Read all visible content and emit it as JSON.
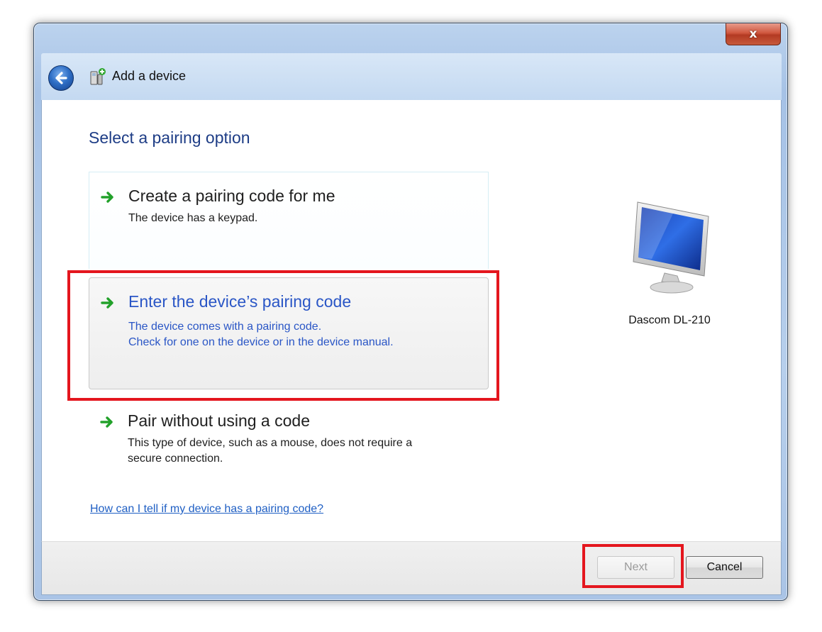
{
  "window": {
    "title": "Add a device",
    "close_symbol": "x",
    "icons": {
      "back": "back-arrow-icon",
      "title": "add-device-icon",
      "close": "close-icon"
    }
  },
  "page": {
    "heading": "Select a pairing option"
  },
  "options": [
    {
      "title": "Create a pairing code for me",
      "description": [
        "The device has a keypad."
      ],
      "icon": "green-arrow-icon",
      "style": "normal"
    },
    {
      "title": "Enter the device’s pairing code",
      "description": [
        "The device comes with a pairing code.",
        "Check for one on the device or in the device manual."
      ],
      "icon": "green-arrow-icon",
      "style": "hovered"
    },
    {
      "title": "Pair without using a code",
      "description": [
        "This type of device, such as a mouse, does not require a",
        "secure connection."
      ],
      "icon": "green-arrow-icon",
      "style": "normal"
    }
  ],
  "help_link": "How can I tell if my device has a pairing code?",
  "device": {
    "name": "Dascom DL-210",
    "icon": "monitor-icon"
  },
  "buttons": {
    "next": "Next",
    "next_enabled": false,
    "cancel": "Cancel"
  },
  "colors": {
    "highlight": "#e4161e",
    "link_blue": "#2a56c6",
    "heading_blue": "#1e3d86",
    "arrow_green": "#22a12a"
  }
}
